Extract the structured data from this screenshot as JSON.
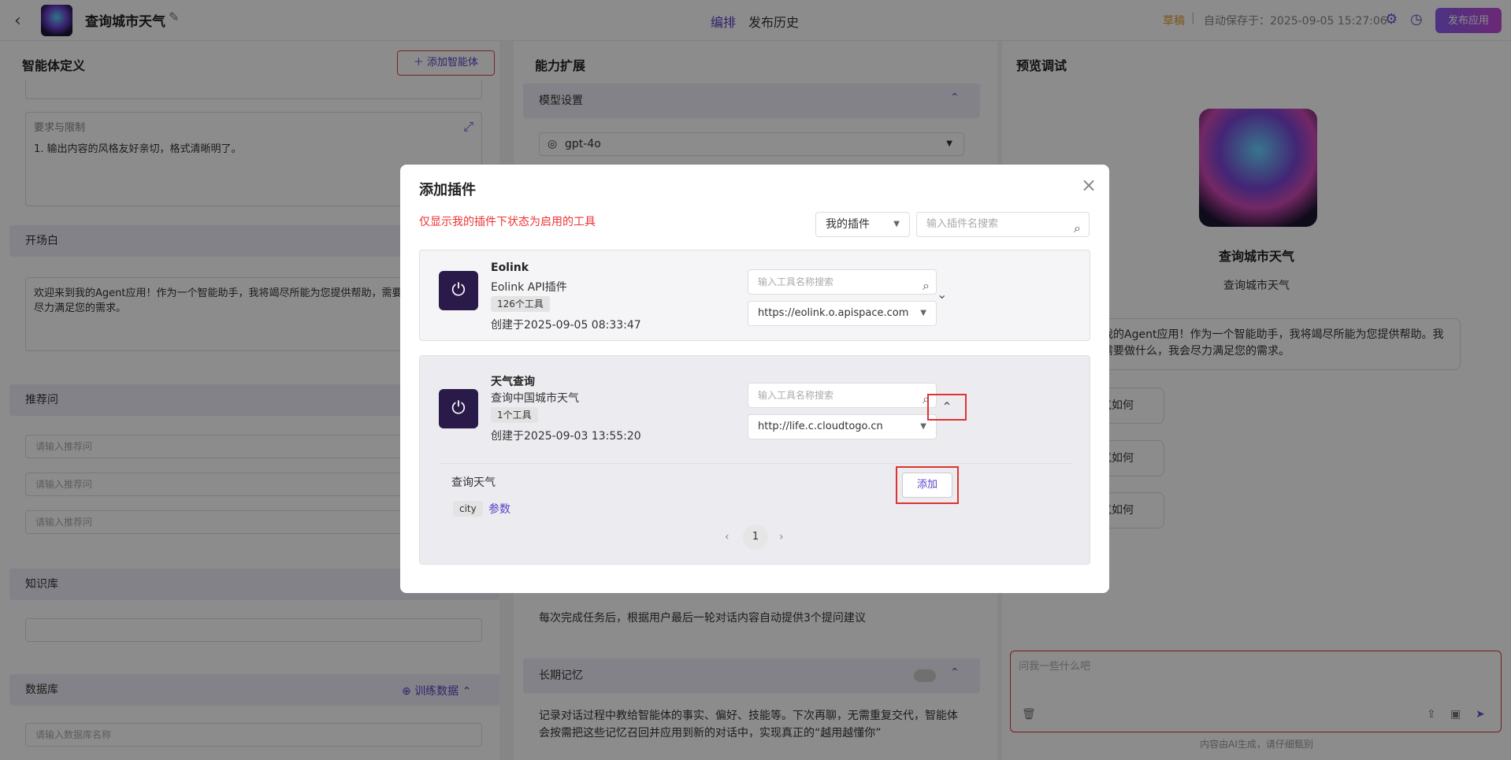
{
  "header": {
    "back_icon": "chevron-left-icon",
    "app_name": "查询城市天气",
    "edit_icon": "pencil-icon",
    "tabs": [
      "编排",
      "发布历史"
    ],
    "draft_label": "草稿",
    "separator": "|",
    "autosave": "自动保存于：2025-09-05 15:27:06",
    "publish_label": "发布应用"
  },
  "left": {
    "title": "智能体定义",
    "add_agent_label": "＋  添加智能体",
    "requirements_label": "要求与限制",
    "requirements_text": "1. 输出内容的风格友好亲切，格式清晰明了。",
    "opening_label": "开场白",
    "opening_text": "欢迎来到我的Agent应用！作为一个智能助手，我将竭尽所能为您提供帮助，需要做什么，我会尽力满足您的需求。",
    "recommend_label": "推荐问",
    "recommend_placeholder": "请输入推荐问",
    "knowledge_label": "知识库",
    "database_label": "数据库",
    "train_label": "训练数据",
    "db_placeholder": "请输入数据库名称"
  },
  "middle": {
    "title": "能力扩展",
    "model_settings": "模型设置",
    "model": "gpt-4o",
    "suggest_text": "每次完成任务后，根据用户最后一轮对话内容自动提供3个提问建议",
    "memory_label": "长期记忆",
    "memory_text": "记录对话过程中教给智能体的事实、偏好、技能等。下次再聊，无需重复交代，智能体会按需把这些记忆召回并应用到新的对话中，实现真正的“越用越懂你”"
  },
  "right": {
    "title": "预览调试",
    "bot_name": "查询城市天气",
    "bot_desc": "查询城市天气",
    "greeting": "到我的Agent应用！作为一个智能助手，我将竭尽所能为您提供帮助。我您需要做什么，我会尽力满足您的需求。",
    "suggestions": [
      "天气如何",
      "天气如何",
      "天气如何"
    ],
    "input_placeholder": "问我一些什么吧",
    "footer_note": "内容由AI生成，请仔细甄别"
  },
  "modal": {
    "title": "添加插件",
    "note": "仅显示我的插件下状态为启用的工具",
    "filter_value": "我的插件",
    "search_placeholder": "输入插件名搜索",
    "plugins": [
      {
        "name": "Eolink",
        "desc": "Eolink API插件",
        "tool_count": "126个工具",
        "created": "创建于2025-09-05 08:33:47",
        "tool_search_placeholder": "输入工具名称搜索",
        "url": "https://eolink.o.apispace.com"
      },
      {
        "name": "天气查询",
        "desc": "查询中国城市天气",
        "tool_count": "1个工具",
        "created": "创建于2025-09-03 13:55:20",
        "tool_search_placeholder": "输入工具名称搜索",
        "url": "http://life.c.cloudtogo.cn",
        "tool_name": "查询天气",
        "param": "city",
        "param_link": "参数",
        "add_label": "添加"
      }
    ],
    "page": "1"
  }
}
